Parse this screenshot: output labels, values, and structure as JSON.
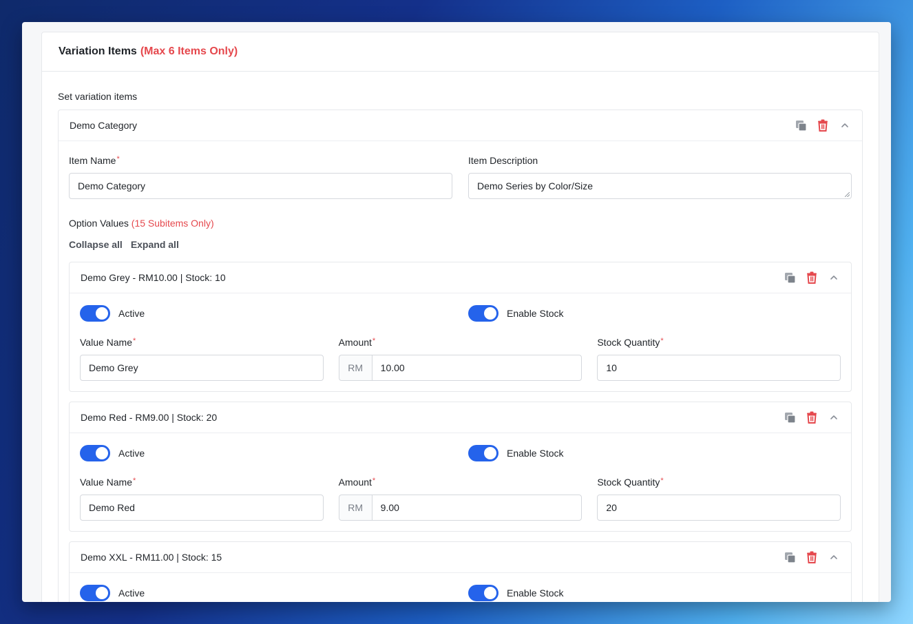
{
  "header": {
    "title": "Variation Items",
    "limit_note": "(Max 6 Items Only)"
  },
  "section_label": "Set variation items",
  "category": {
    "title": "Demo Category",
    "item_name_label": "Item Name",
    "item_name_value": "Demo Category",
    "item_desc_label": "Item Description",
    "item_desc_value": "Demo Series by Color/Size",
    "option_values_label": "Option Values",
    "option_values_note": "(15 Subitems Only)",
    "collapse_all": "Collapse all",
    "expand_all": "Expand all"
  },
  "required_mark": "*",
  "labels": {
    "active": "Active",
    "enable_stock": "Enable Stock",
    "value_name": "Value Name",
    "amount": "Amount",
    "stock_quantity": "Stock Quantity",
    "currency": "RM"
  },
  "subitems": [
    {
      "title": "Demo Grey - RM10.00 | Stock: 10",
      "value_name": "Demo Grey",
      "amount": "10.00",
      "stock": "10",
      "active": true,
      "enable_stock": true
    },
    {
      "title": "Demo Red - RM9.00 | Stock: 20",
      "value_name": "Demo Red",
      "amount": "9.00",
      "stock": "20",
      "active": true,
      "enable_stock": true
    },
    {
      "title": "Demo XXL - RM11.00 | Stock: 15",
      "value_name": "",
      "amount": "",
      "stock": "",
      "active": true,
      "enable_stock": true
    }
  ],
  "icons": {
    "copy": "copy-icon",
    "delete": "trash-icon",
    "collapse": "chevron-up-icon"
  },
  "colors": {
    "accent": "#2563eb",
    "danger": "#e5484d",
    "icon_grey": "#8a8f98"
  }
}
